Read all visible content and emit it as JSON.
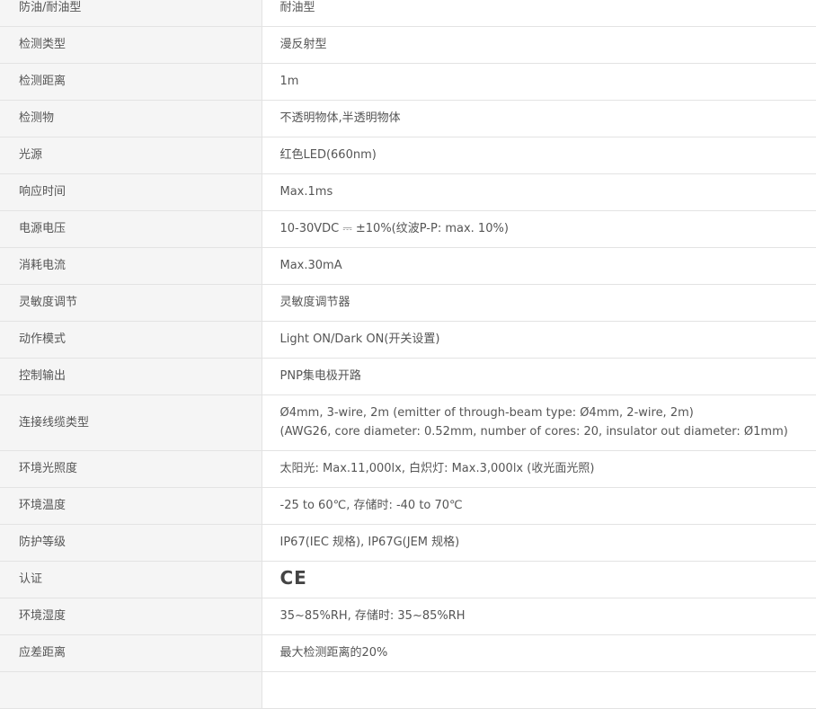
{
  "rows": [
    {
      "label": "防油/耐油型",
      "value": "耐油型"
    },
    {
      "label": "检测类型",
      "value": "漫反射型"
    },
    {
      "label": "检测距离",
      "value": "1m"
    },
    {
      "label": "检测物",
      "value": "不透明物体,半透明物体"
    },
    {
      "label": "光源",
      "value": "红色LED(660nm)"
    },
    {
      "label": "响应时间",
      "value": "Max.1ms"
    },
    {
      "label": "电源电压",
      "value": "10-30VDC ⎓ ±10%(纹波P-P: max. 10%)"
    },
    {
      "label": "消耗电流",
      "value": "Max.30mA"
    },
    {
      "label": "灵敏度调节",
      "value": "灵敏度调节器"
    },
    {
      "label": "动作模式",
      "value": "Light ON/Dark ON(开关设置)"
    },
    {
      "label": "控制输出",
      "value": "PNP集电极开路"
    },
    {
      "label": "连接线缆类型",
      "value_line1": "Ø4mm, 3-wire, 2m (emitter of through-beam type: Ø4mm, 2-wire, 2m)",
      "value_line2": "(AWG26, core diameter: 0.52mm, number of cores: 20, insulator out diameter: Ø1mm)"
    },
    {
      "label": "环境光照度",
      "value": "太阳光: Max.11,000lx, 白炽灯: Max.3,000lx (收光面光照)"
    },
    {
      "label": "环境温度",
      "value": "-25 to 60℃, 存储时: -40 to 70℃"
    },
    {
      "label": "防护等级",
      "value": "IP67(IEC 规格), IP67G(JEM 规格)"
    },
    {
      "label": "认证",
      "value_icon": "ce-mark-icon",
      "value_icon_text": "CE"
    },
    {
      "label": "环境湿度",
      "value": "35~85%RH, 存储时: 35~85%RH"
    },
    {
      "label": "应差距离",
      "value": "最大检测距离的20%"
    },
    {
      "label": "",
      "value": ""
    }
  ]
}
